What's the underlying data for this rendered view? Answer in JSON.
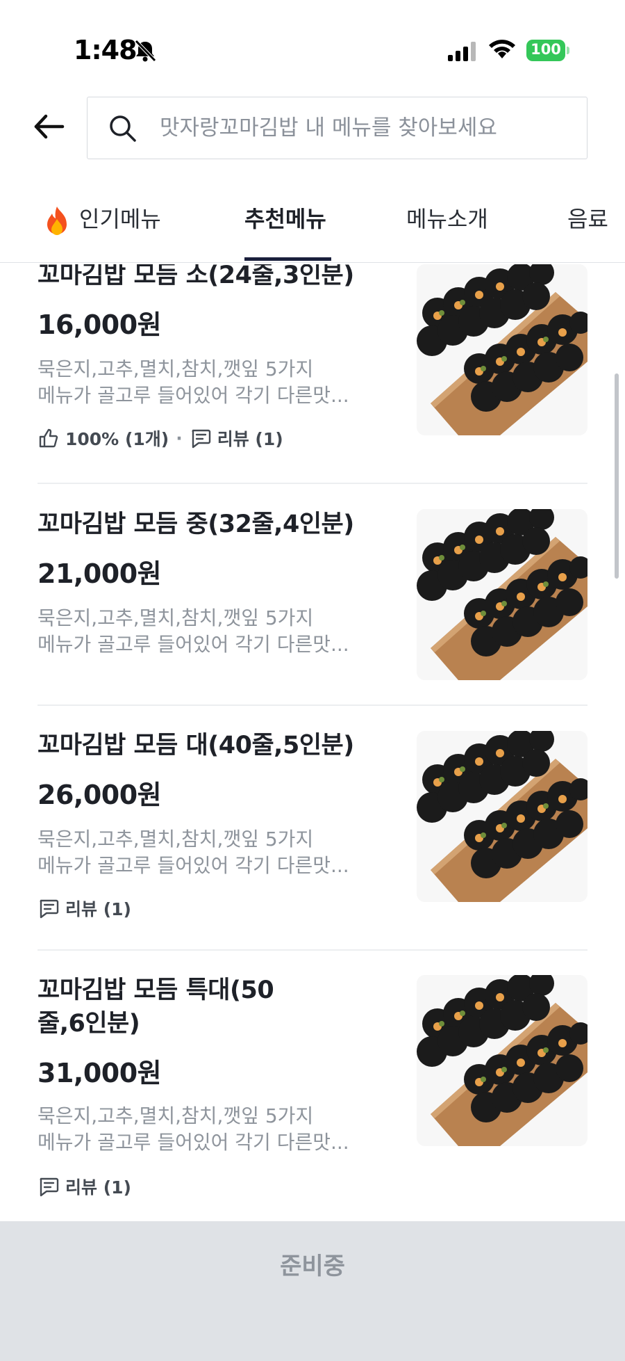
{
  "status_bar": {
    "time": "1:48",
    "battery": "100"
  },
  "search": {
    "placeholder": "맛자랑꼬마김밥 내 메뉴를 찾아보세요"
  },
  "tabs": [
    {
      "label": "인기메뉴",
      "icon": "fire-icon",
      "active": false
    },
    {
      "label": "추천메뉴",
      "active": true
    },
    {
      "label": "메뉴소개",
      "active": false
    },
    {
      "label": "음료",
      "active": false
    }
  ],
  "menu_items": [
    {
      "name": "꼬마김밥 모듬 소(24줄,3인분)",
      "price": "16,000원",
      "desc_line1": "묵은지,고추,멸치,참치,깻잎  5가지",
      "desc_line2": "메뉴가  골고루 들어있어  각기 다른맛...",
      "like": "100% (1개)",
      "review": "리뷰 (1)"
    },
    {
      "name": "꼬마김밥 모듬 중(32줄,4인분)",
      "price": "21,000원",
      "desc_line1": "묵은지,고추,멸치,참치,깻잎  5가지",
      "desc_line2": "메뉴가  골고루 들어있어  각기 다른맛..."
    },
    {
      "name": "꼬마김밥 모듬 대(40줄,5인분)",
      "price": "26,000원",
      "desc_line1": "묵은지,고추,멸치,참치,깻잎  5가지",
      "desc_line2": "메뉴가  골고루 들어있어  각기 다른맛...",
      "review": "리뷰 (1)"
    },
    {
      "name_line1": "꼬마김밥 모듬 특대(50",
      "name_line2": "줄,6인분)",
      "price": "31,000원",
      "desc_line1": "묵은지,고추,멸치,참치,깻잎  5가지",
      "desc_line2": "메뉴가  골고루 들어있어  각기 다른맛...",
      "review": "리뷰 (1)"
    }
  ],
  "bottom": {
    "button_label": "준비중"
  }
}
